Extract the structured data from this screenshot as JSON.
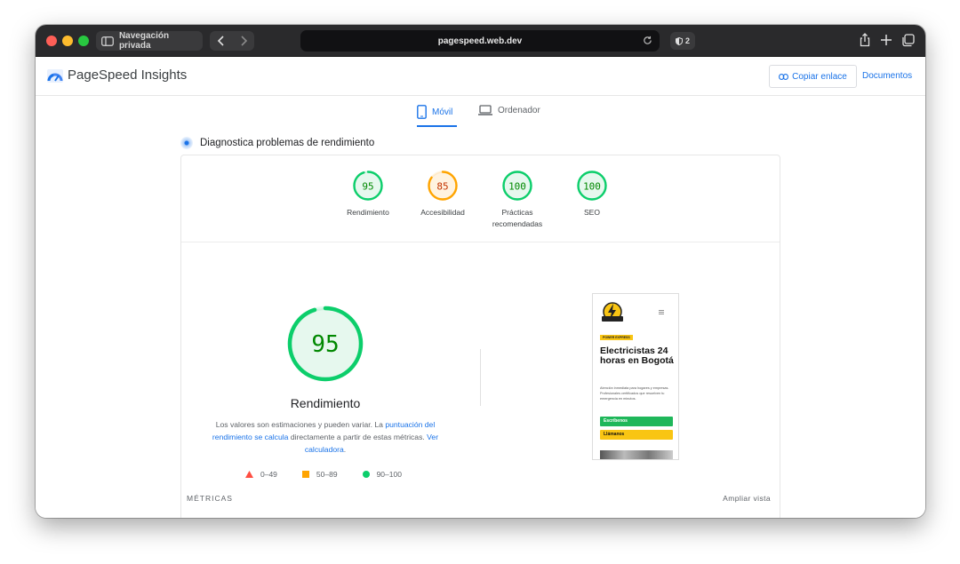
{
  "browser": {
    "private_label": "Navegación privada",
    "url": "pagespeed.web.dev",
    "shield_count": "2"
  },
  "header": {
    "title": "PageSpeed Insights",
    "copy_link_label": "Copiar enlace",
    "docs_label": "Documentos"
  },
  "device_tabs": {
    "mobile_label": "Móvil",
    "desktop_label": "Ordenador",
    "active": "Móvil"
  },
  "diagnostics": {
    "title": "Diagnostica problemas de rendimiento"
  },
  "scores": [
    {
      "value": 95,
      "label": "Rendimiento",
      "color": "#0cce6b",
      "text_color": "#008800",
      "bg": "#e6f8ee"
    },
    {
      "value": 85,
      "label": "Accesibilidad",
      "color": "#ffa400",
      "text_color": "#c33300",
      "bg": "#fff3e0"
    },
    {
      "value": 100,
      "label": "Prácticas recomendadas",
      "color": "#0cce6b",
      "text_color": "#008800",
      "bg": "#e6f8ee"
    },
    {
      "value": 100,
      "label": "SEO",
      "color": "#0cce6b",
      "text_color": "#008800",
      "bg": "#e6f8ee"
    }
  ],
  "performance": {
    "score": 95,
    "label": "Rendimiento",
    "desc_part1": "Los valores son estimaciones y pueden variar. La ",
    "desc_link1": "puntuación del rendimiento se calcula",
    "desc_part2": " directamente a partir de estas métricas. ",
    "desc_link2": "Ver calculadora",
    "desc_part3": "."
  },
  "legend": [
    {
      "range": "0–49",
      "shape": "triangle",
      "color": "#ff4e42"
    },
    {
      "range": "50–89",
      "shape": "square",
      "color": "#ffa400"
    },
    {
      "range": "90–100",
      "shape": "circle",
      "color": "#0cce6b"
    }
  ],
  "preview": {
    "badge": "POWER EXPRESS",
    "heading": "Electricistas 24 horas en Bogotá",
    "paragraph": "Atención inmediata para hogares y empresas. Profesionales certificados que resuelven tu emergencia en minutos.",
    "cta1": "Escríbenos",
    "cta2": "Llámanos",
    "cta1_color": "#1fb75a",
    "cta2_color": "#f9c513"
  },
  "metrics": {
    "section_label": "MÉTRICAS",
    "expand_label": "Ampliar vista"
  }
}
